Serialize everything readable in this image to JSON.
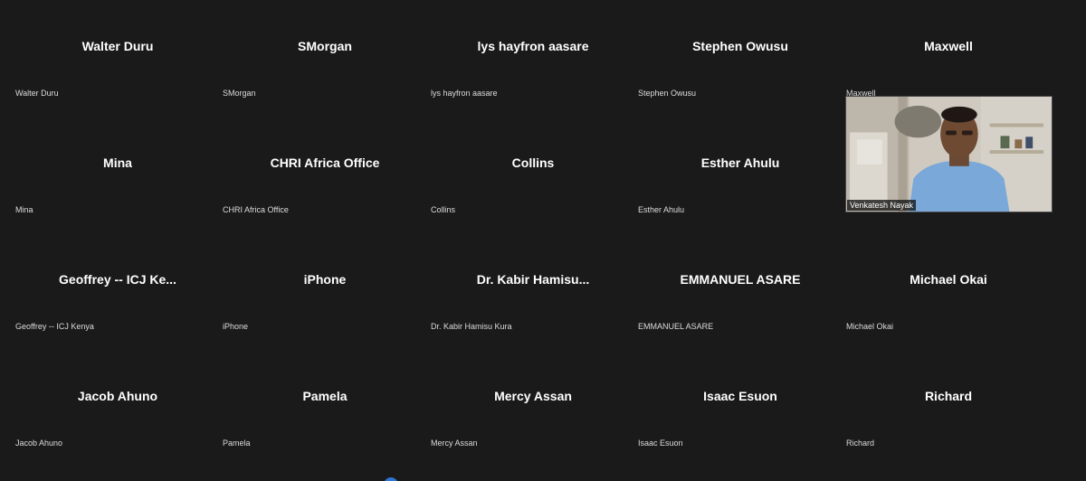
{
  "participants": [
    {
      "display_name": "Walter Duru",
      "label": "Walter Duru"
    },
    {
      "display_name": "SMorgan",
      "label": "SMorgan"
    },
    {
      "display_name": "lys hayfron aasare",
      "label": "lys hayfron aasare"
    },
    {
      "display_name": "Stephen Owusu",
      "label": "Stephen Owusu"
    },
    {
      "display_name": "Maxwell",
      "label": "Maxwell"
    },
    {
      "display_name": "Mina",
      "label": "Mina"
    },
    {
      "display_name": "CHRI Africa Office",
      "label": "CHRI Africa Office"
    },
    {
      "display_name": "Collins",
      "label": "Collins"
    },
    {
      "display_name": "Esther Ahulu",
      "label": "Esther Ahulu"
    },
    {
      "display_name": "",
      "label": "Venkatesh Nayak",
      "video": true
    },
    {
      "display_name": "Geoffrey -- ICJ Ke...",
      "label": "Geoffrey -- ICJ Kenya"
    },
    {
      "display_name": "iPhone",
      "label": "iPhone"
    },
    {
      "display_name": "Dr. Kabir Hamisu...",
      "label": "Dr. Kabir Hamisu Kura"
    },
    {
      "display_name": "EMMANUEL ASARE",
      "label": "EMMANUEL ASARE"
    },
    {
      "display_name": "Michael Okai",
      "label": "Michael Okai"
    },
    {
      "display_name": "Jacob Ahuno",
      "label": "Jacob Ahuno"
    },
    {
      "display_name": "Pamela",
      "label": "Pamela"
    },
    {
      "display_name": "Mercy Assan",
      "label": "Mercy Assan"
    },
    {
      "display_name": "Isaac Esuon",
      "label": "Isaac Esuon"
    },
    {
      "display_name": "Richard",
      "label": "Richard"
    }
  ],
  "colors": {
    "background": "#1a1a1a",
    "label_text": "#dcdcdc",
    "name_text": "#ffffff",
    "accent": "#2f76d2"
  }
}
